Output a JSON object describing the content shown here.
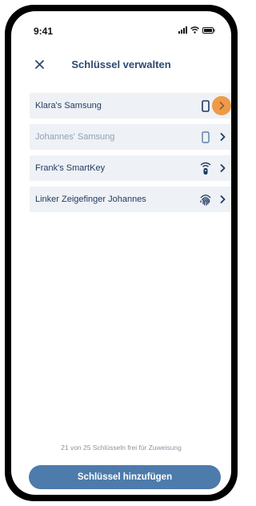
{
  "status_bar": {
    "time": "9:41"
  },
  "header": {
    "title": "Schlüssel verwalten",
    "close_icon": "close-icon"
  },
  "keys": [
    {
      "label": "Klara's Samsung",
      "icon": "phone-icon",
      "state": "active",
      "chevron_highlighted": true
    },
    {
      "label": "Johannes' Samsung",
      "icon": "phone-icon",
      "state": "disabled",
      "chevron_highlighted": false
    },
    {
      "label": "Frank's SmartKey",
      "icon": "smartkey-icon",
      "state": "active",
      "chevron_highlighted": false
    },
    {
      "label": "Linker Zeigefinger Johannes",
      "icon": "fingerprint-icon",
      "state": "active",
      "chevron_highlighted": false
    }
  ],
  "footer": {
    "counter_text": "21 von 25 Schlüsseln frei für Zuweisung",
    "add_button_label": "Schlüssel hinzufügen"
  },
  "colors": {
    "primary": "#4d7bab",
    "title": "#2c4a70",
    "row_background": "#eef1f5",
    "highlight": "#ee9a4a",
    "disabled_text": "#8fa0b5"
  }
}
